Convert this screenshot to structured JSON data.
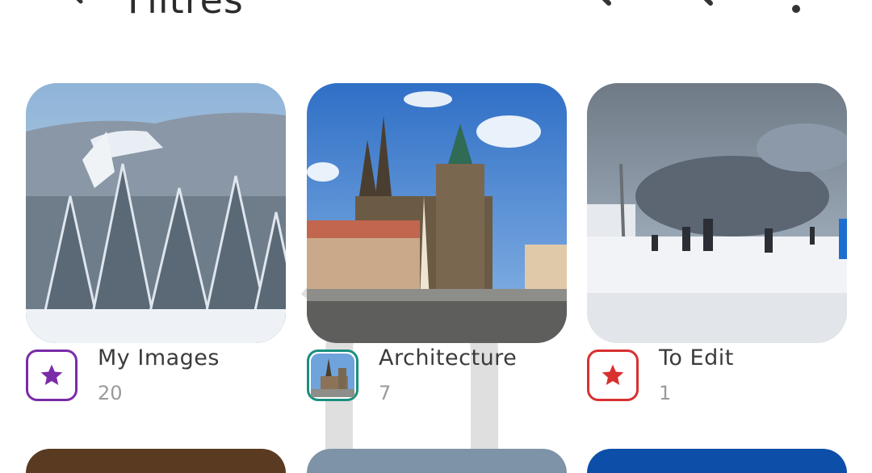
{
  "header": {
    "title": "Filtres",
    "icons": [
      "back-arrow-icon",
      "search-icon",
      "search-icon",
      "more-vert-icon"
    ]
  },
  "albums": [
    {
      "name": "My Images",
      "count": "20",
      "badge_icon": "star-icon",
      "badge_color": "#7a2ca8"
    },
    {
      "name": "Architecture",
      "count": "7",
      "badge_icon": "thumbnail",
      "badge_color": "#1a8f7e"
    },
    {
      "name": "To Edit",
      "count": "1",
      "badge_icon": "star-icon",
      "badge_color": "#d93030"
    }
  ]
}
